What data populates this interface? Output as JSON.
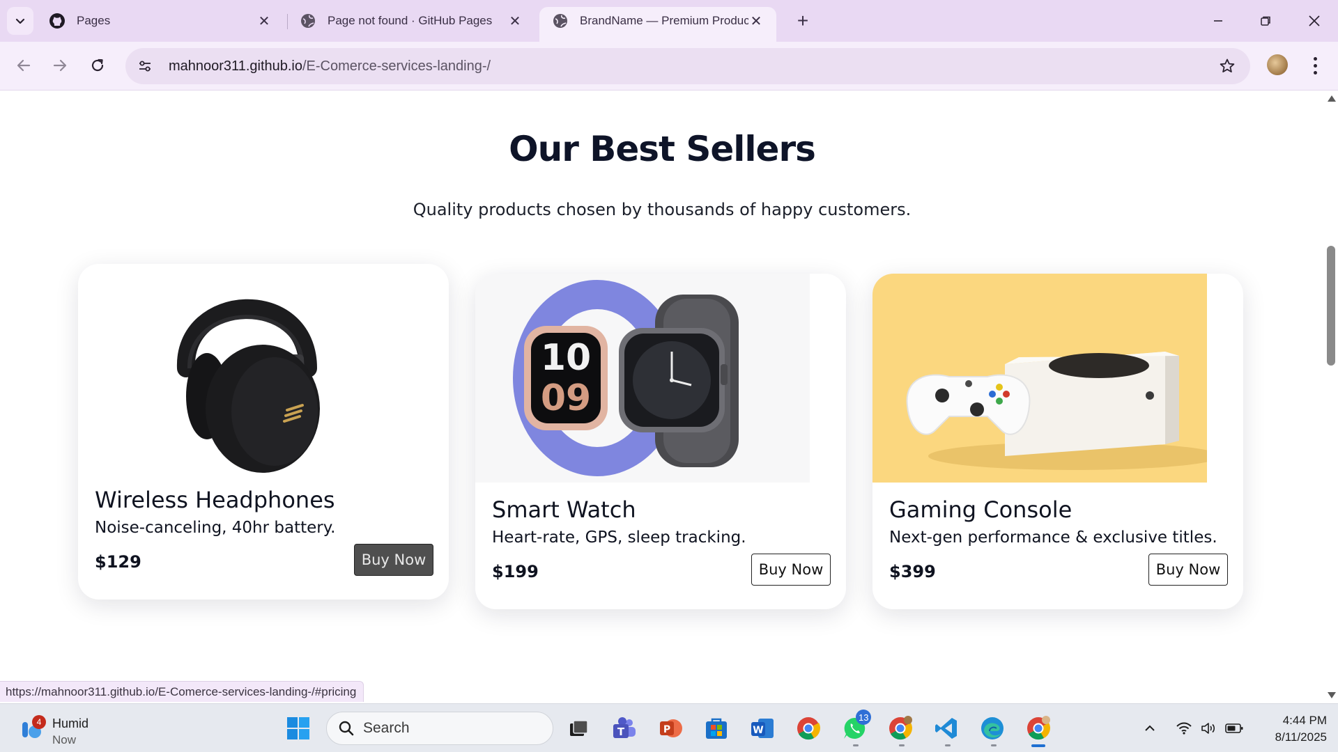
{
  "browser": {
    "tabs": [
      {
        "title": "Pages",
        "favicon": "github-icon",
        "active": false
      },
      {
        "title": "Page not found · GitHub Pages",
        "favicon": "globe-icon",
        "active": false
      },
      {
        "title": "BrandName — Premium Produc",
        "favicon": "globe-icon",
        "active": true
      }
    ],
    "url_host": "mahnoor311.github.io",
    "url_path": "/E-Comerce-services-landing-/",
    "status_link": "https://mahnoor311.github.io/E-Comerce-services-landing-/#pricing"
  },
  "page": {
    "section_title": "Our Best Sellers",
    "section_subtitle": "Quality products chosen by thousands of happy customers.",
    "products": [
      {
        "name": "Wireless Headphones",
        "description": "Noise-canceling, 40hr battery.",
        "price": "$129",
        "button": "Buy Now",
        "image": "headphones-image"
      },
      {
        "name": "Smart Watch",
        "description": "Heart-rate, GPS, sleep tracking.",
        "price": "$199",
        "button": "Buy Now",
        "image": "smartwatch-image"
      },
      {
        "name": "Gaming Console",
        "description": "Next-gen performance & exclusive titles.",
        "price": "$399",
        "button": "Buy Now",
        "image": "console-image"
      }
    ]
  },
  "taskbar": {
    "weather_title": "Humid",
    "weather_sub": "Now",
    "weather_badge": "4",
    "search_placeholder": "Search",
    "whatsapp_badge": "13",
    "time": "4:44 PM",
    "date": "8/11/2025"
  },
  "colors": {
    "tabstrip": "#e9d9f3",
    "toolbar": "#f6eefb",
    "heading": "#0e1428",
    "console_bg": "#fbd77f",
    "watch_band": "#7f86df"
  }
}
